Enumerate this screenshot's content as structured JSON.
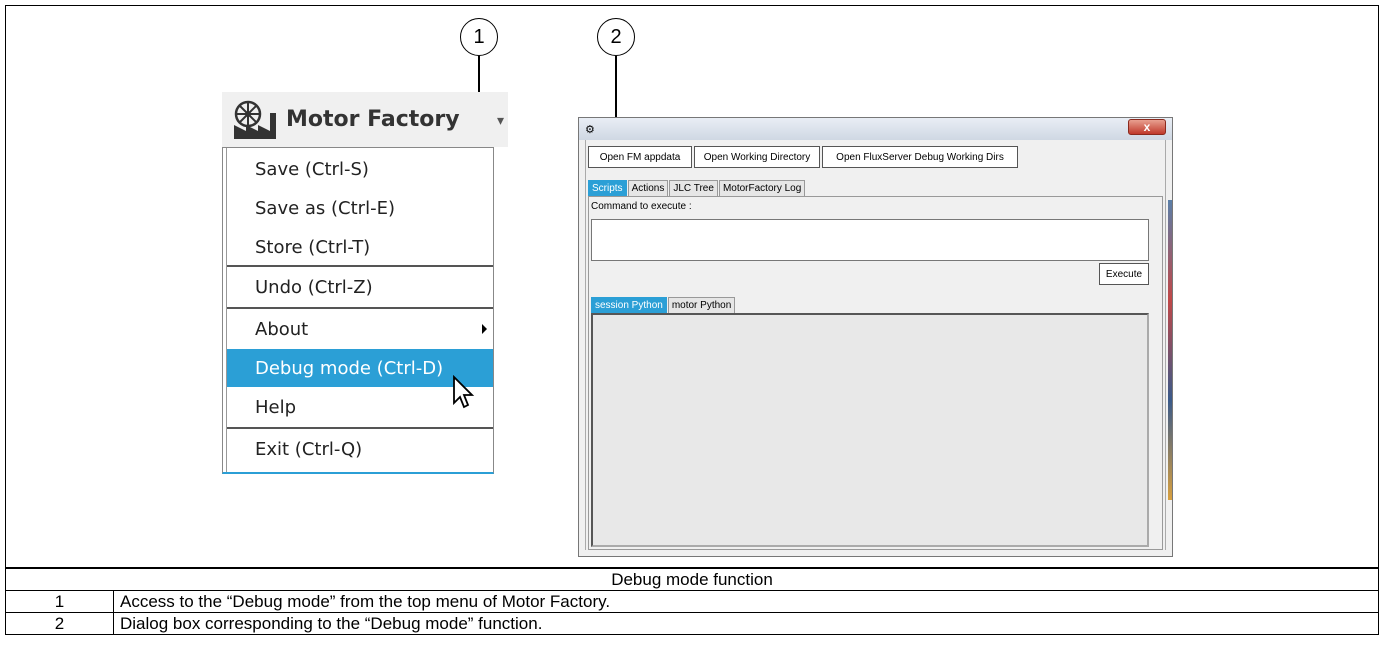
{
  "callouts": [
    "1",
    "2"
  ],
  "motor_factory": {
    "title": "Motor Factory",
    "menu_items": [
      {
        "label": "Save (Ctrl-S)"
      },
      {
        "label": "Save as (Ctrl-E)"
      },
      {
        "label": "Store (Ctrl-T)"
      },
      {
        "label": "Undo (Ctrl-Z)"
      },
      {
        "label": "About"
      },
      {
        "label": "Debug mode (Ctrl-D)"
      },
      {
        "label": "Help"
      },
      {
        "label": "Exit (Ctrl-Q)"
      }
    ],
    "accent_color": "#2b9fd6"
  },
  "dialog": {
    "close_label": "x",
    "top_buttons": [
      "Open FM appdata",
      "Open Working Directory",
      "Open FluxServer Debug Working Dirs"
    ],
    "tabs": [
      "Scripts",
      "Actions",
      "JLC Tree",
      "MotorFactory Log"
    ],
    "command_label": "Command to execute :",
    "execute_label": "Execute",
    "sub_tabs": [
      "session Python",
      "motor Python"
    ]
  },
  "caption_table": {
    "title": "Debug mode function",
    "rows": [
      {
        "num": "1",
        "text": "Access to the “Debug mode” from the top menu of Motor Factory."
      },
      {
        "num": "2",
        "text": "Dialog box corresponding to the “Debug mode” function."
      }
    ]
  }
}
